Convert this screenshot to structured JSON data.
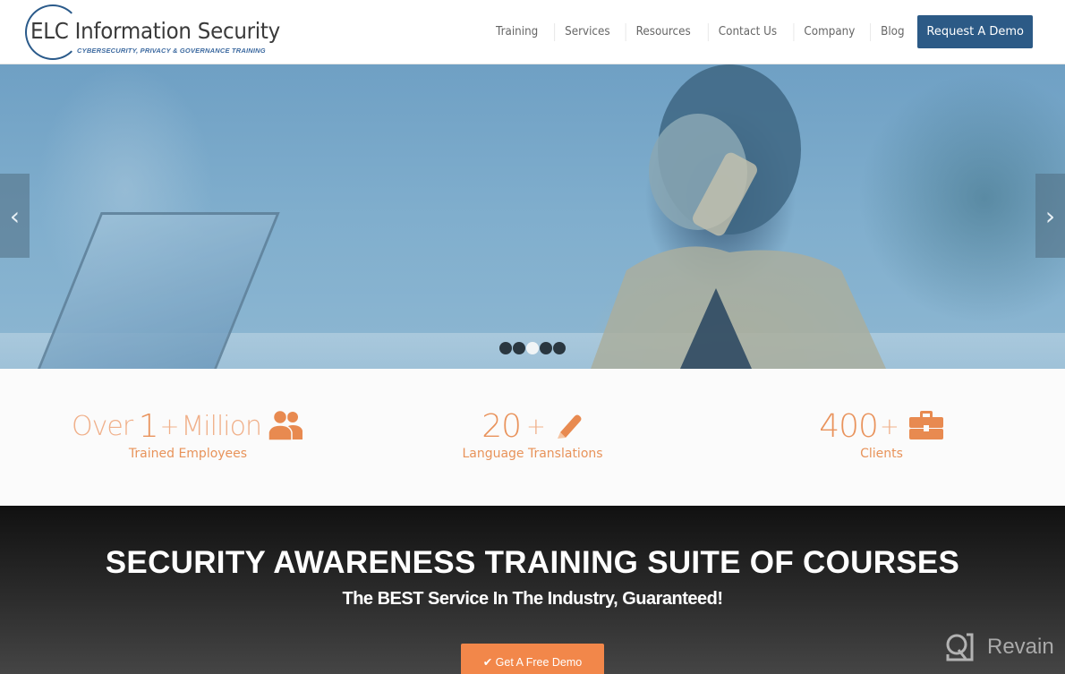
{
  "header": {
    "logo_title": "ELC Information Security",
    "logo_subtitle": "CYBERSECURITY, PRIVACY & GOVERNANCE TRAINING",
    "nav": [
      {
        "label": "Training"
      },
      {
        "label": "Services"
      },
      {
        "label": "Resources"
      },
      {
        "label": "Contact Us"
      },
      {
        "label": "Company"
      },
      {
        "label": "Blog"
      }
    ],
    "cta_label": "Request A Demo",
    "brand_color": "#2c5a86"
  },
  "hero": {
    "prev_icon": "‹",
    "next_icon": "›",
    "slide_count": 5,
    "active_slide": 3
  },
  "stats": [
    {
      "prefix": "Over",
      "number": "1",
      "suffix": "+",
      "tail": "Million",
      "label": "Trained Employees",
      "icon": "users-icon"
    },
    {
      "prefix": "",
      "number": "20",
      "suffix": "+",
      "tail": "",
      "label": "Language Translations",
      "icon": "pencil-icon"
    },
    {
      "prefix": "",
      "number": "400",
      "suffix": "+",
      "tail": "",
      "label": "Clients",
      "icon": "briefcase-icon"
    }
  ],
  "accent_color": "#f2874a",
  "cta": {
    "title": "SECURITY AWARENESS TRAINING SUITE OF COURSES",
    "subtitle": "The BEST Service In The Industry, Guaranteed!",
    "button_label": "✔ Get A Free Demo"
  },
  "watermark": {
    "text": "Revain"
  }
}
